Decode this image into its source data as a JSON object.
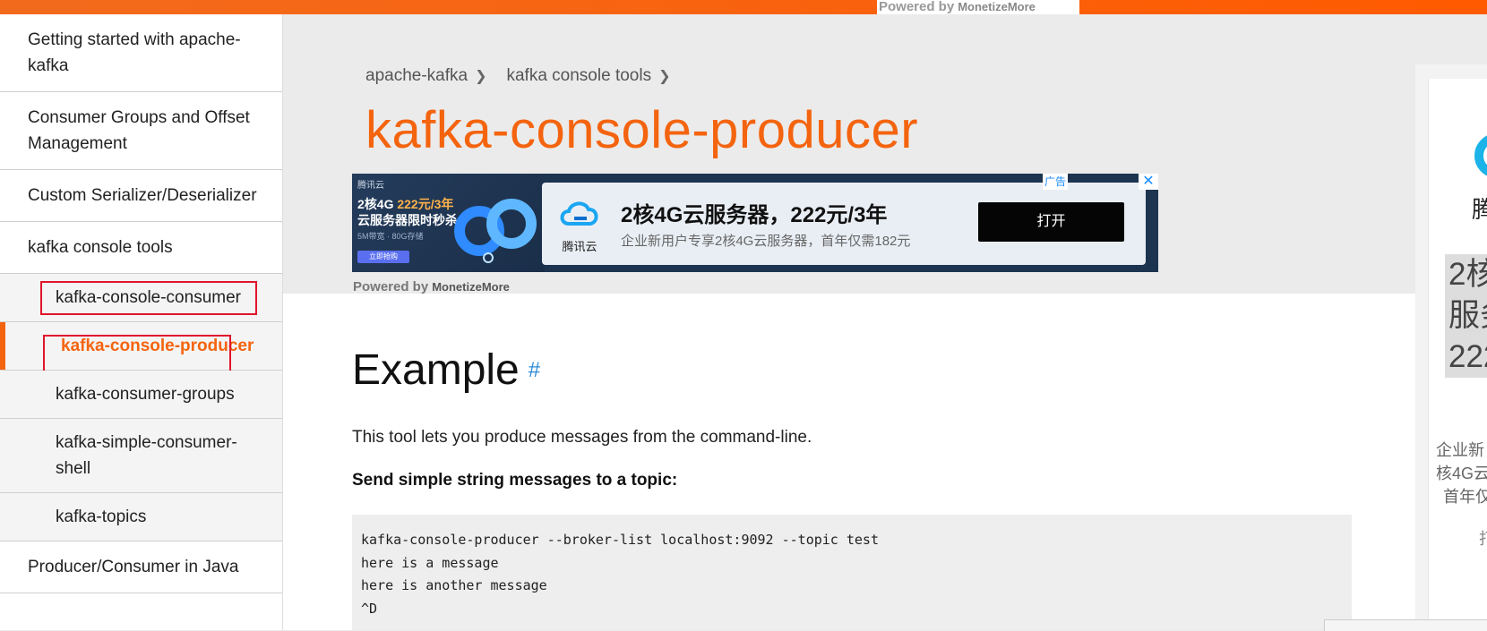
{
  "top_banner": {
    "powered_by": "Powered by",
    "brand": "MonetizeMore"
  },
  "sidebar": {
    "items": [
      {
        "label": "Getting started with apache-kafka"
      },
      {
        "label": "Consumer Groups and Offset Management"
      },
      {
        "label": "Custom Serializer/Deserializer"
      },
      {
        "label": "kafka console tools"
      },
      {
        "label": "kafka-console-consumer"
      },
      {
        "label": "kafka-console-producer"
      },
      {
        "label": "kafka-consumer-groups"
      },
      {
        "label": "kafka-simple-consumer-shell"
      },
      {
        "label": "kafka-topics"
      },
      {
        "label": "Producer/Consumer in Java"
      }
    ],
    "active_index": 5
  },
  "breadcrumb": {
    "items": [
      "apache-kafka",
      "kafka console tools"
    ]
  },
  "page": {
    "title": "kafka-console-producer"
  },
  "ad_banner": {
    "small_brand": "腾讯云",
    "left_line1_a": "2核4G ",
    "left_line1_b": "222元/3年",
    "left_line2": "云服务器限时秒杀",
    "left_line3": "5M带宽 · 80G存储",
    "left_cta": "立即抢购",
    "logo_text": "腾讯云",
    "headline": "2核4G云服务器，222元/3年",
    "description": "企业新用户专享2核4G云服务器，首年仅需182元",
    "button": "打开",
    "ad_label": "广告",
    "close": "✕",
    "powered_by": "Powered by",
    "brand": "MonetizeMore"
  },
  "content": {
    "example_heading": "Example",
    "anchor": "#",
    "intro": "This tool lets you produce messages from the command-line.",
    "subheading": "Send simple string messages to a topic:",
    "code": "kafka-console-producer --broker-list localhost:9092 --topic test\nhere is a message\nhere is another message\n^D"
  },
  "right_ad": {
    "brand": "腾",
    "headline_l1": "2核",
    "headline_l2": "服务",
    "headline_l3": "222",
    "desc_l1": "企业新",
    "desc_l2": "核4G云",
    "desc_l3": "首年仅",
    "button": "打"
  },
  "colors": {
    "accent": "#f4640f",
    "top_bar": "#ff5a00",
    "highlight_box": "#e0152b",
    "anchor_link": "#2f8bd8"
  }
}
